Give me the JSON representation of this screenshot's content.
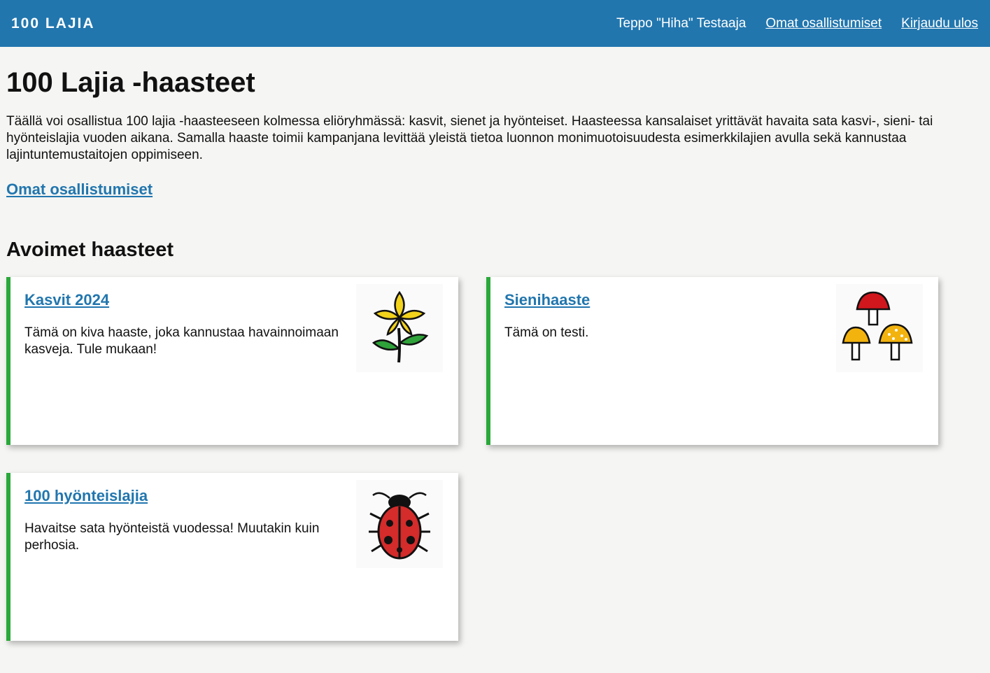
{
  "header": {
    "brand": "100 LAJIA",
    "user_name": "Teppo \"Hiha\" Testaaja",
    "own_participations": "Omat osallistumiset",
    "logout": "Kirjaudu ulos"
  },
  "page": {
    "title": "100 Lajia -haasteet",
    "intro": "Täällä voi osallistua 100 lajia -haasteeseen kolmessa eliöryhmässä: kasvit, sienet ja hyönteiset. Haasteessa kansalaiset yrittävät havaita sata kasvi-, sieni- tai hyönteislajia vuoden aikana. Samalla haaste toimii kampanjana levittää yleistä tietoa luonnon monimuotoisuudesta esimerkkilajien avulla sekä kannustaa lajintuntemustaitojen oppimiseen.",
    "own_link": "Omat osallistumiset",
    "open_heading": "Avoimet haasteet"
  },
  "challenges": [
    {
      "title": "Kasvit 2024",
      "description": "Tämä on kiva haaste, joka kannustaa havainnoimaan kasveja. Tule mukaan!",
      "icon": "flower-icon"
    },
    {
      "title": "Sienihaaste",
      "description": "Tämä on testi.",
      "icon": "mushroom-icon"
    },
    {
      "title": "100 hyönteislajia",
      "description": "Havaitse sata hyönteistä vuodessa! Muutakin kuin perhosia.",
      "icon": "ladybug-icon"
    }
  ],
  "colors": {
    "header_bg": "#2176ae",
    "link": "#2176ae",
    "card_accent": "#2aa83a",
    "page_bg": "#f5f5f3"
  }
}
